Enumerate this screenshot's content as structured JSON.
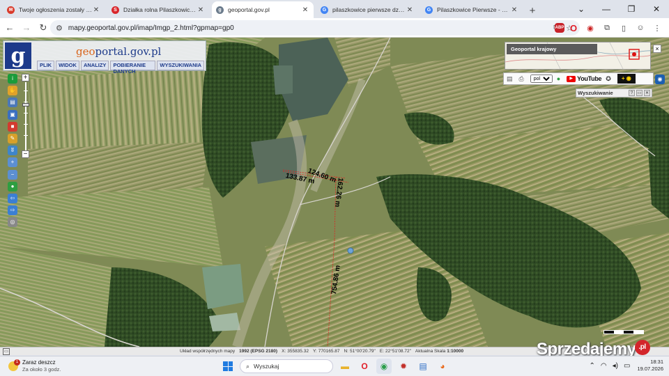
{
  "browser": {
    "tabs": [
      {
        "title": "Twoje ogłoszenia zostały przedł",
        "favicon_color": "#d93a2b",
        "favicon_glyph": "✉"
      },
      {
        "title": "Działka rolna Pilaszkowice Pierws",
        "favicon_color": "#d9262b",
        "favicon_glyph": "S"
      },
      {
        "title": "geoportal.gov.pl",
        "favicon_color": "#6b7b8c",
        "favicon_glyph": "g"
      },
      {
        "title": "pilaszkowice pierwsze działka 8",
        "favicon_color": "#4285f4",
        "favicon_glyph": "G"
      },
      {
        "title": "Pilaszkowice Pierwsze - Szukaj",
        "favicon_color": "#4285f4",
        "favicon_glyph": "G"
      }
    ],
    "new_tab": "+",
    "address": "mapy.geoportal.gov.pl/imap/Imgp_2.html?gpmap=gp0",
    "window_controls": [
      "⌄",
      "—",
      "❐",
      "✕"
    ],
    "nav": [
      "←",
      "→",
      "↻"
    ]
  },
  "geoportal": {
    "logo_letter": "g",
    "brand_prefix": "geo",
    "brand_suffix": "portal.gov.pl",
    "menu": [
      "PLIK",
      "WIDOK",
      "ANALIZY",
      "POBIERANIE DANYCH",
      "WYSZUKIWANIA"
    ],
    "overview_title": "Geoportal krajowy",
    "language": "pol",
    "youtube_label": "YouTube",
    "search_panel_title": "Wyszukiwanie",
    "search_panel_buttons": [
      "?",
      "▭",
      "✕"
    ],
    "tool_colors": [
      "#1b9b3a",
      "#e0a22a",
      "#4b78b8",
      "#3a6fc1",
      "#d23b2f",
      "#d8a02a",
      "#3f85c9",
      "#5c8fd1",
      "#5c8fd1",
      "#2e9e40",
      "#3b7fd3",
      "#3b7fd3",
      "#888888"
    ],
    "tool_glyphs": [
      "i",
      "✋",
      "▤",
      "▣",
      "■",
      "✎",
      "ʬ",
      "+",
      "−",
      "●",
      "⇦",
      "⇨",
      "◎"
    ],
    "icons": [
      "book-icon",
      "print-icon",
      "globe-icon",
      "accessibility-icon",
      "eye-icon"
    ]
  },
  "measurements": [
    {
      "label": "133.87 m"
    },
    {
      "label": "124.60 m"
    },
    {
      "label": "162.26 m"
    },
    {
      "label": "754.86 m"
    }
  ],
  "status": {
    "system_label": "Układ współrzędnych mapy",
    "system_value": "1992 (EPSG 2180)",
    "x_label": "X:",
    "x_value": "355835.32",
    "y_label": "Y:",
    "y_value": "770165.87",
    "n_label": "N:",
    "n_value": "51°00'20.79\"",
    "e_label": "E:",
    "e_value": "22°51'08.72\"",
    "scale_label": "Aktualna Skala",
    "scale_value": "1:10000"
  },
  "watermark": {
    "text": "Sprzedajemy",
    "suffix": ".pl"
  },
  "taskbar": {
    "weather_badge": "1",
    "weather_title": "Zaraz deszcz",
    "weather_sub": "Za około 3 godz.",
    "search_placeholder": "Wyszukaj",
    "time": "18:31",
    "date": "19.07.2026"
  }
}
